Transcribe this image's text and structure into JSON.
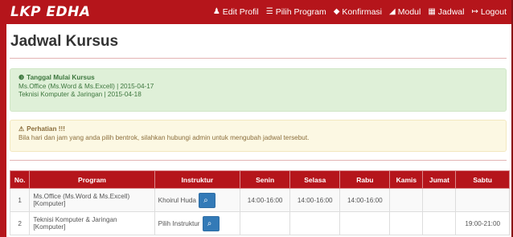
{
  "brand": "LKP EDHA",
  "nav": [
    {
      "label": "Edit Profil",
      "icon": "user-icon",
      "glyph": "♟"
    },
    {
      "label": "Pilih Program",
      "icon": "list-icon",
      "glyph": "☰"
    },
    {
      "label": "Konfirmasi",
      "icon": "tag-icon",
      "glyph": "◆"
    },
    {
      "label": "Modul",
      "icon": "book-icon",
      "glyph": "◢"
    },
    {
      "label": "Jadwal",
      "icon": "calendar-icon",
      "glyph": "▦"
    },
    {
      "label": "Logout",
      "icon": "logout-icon",
      "glyph": "↦"
    }
  ],
  "page_title": "Jadwal Kursus",
  "alert_start": {
    "icon": "info-circle-icon",
    "heading": "Tanggal Mulai Kursus",
    "lines": [
      "Ms.Office (Ms.Word & Ms.Excell) | 2015-04-17",
      "Teknisi Komputer & Jaringan | 2015-04-18"
    ]
  },
  "alert_warning": {
    "icon": "warning-icon",
    "heading": "Perhatian !!!",
    "text": "Bila hari dan jam yang anda pilih bentrok, silahkan hubungi admin untuk mengubah jadwal tersebut."
  },
  "table": {
    "headers": [
      "No.",
      "Program",
      "Instruktur",
      "Senin",
      "Selasa",
      "Rabu",
      "Kamis",
      "Jumat",
      "Sabtu"
    ],
    "rows": [
      {
        "no": "1",
        "program": "Ms.Office (Ms.Word & Ms.Excell) [Komputer]",
        "instruktur": "Khoirul Huda",
        "senin": "14:00-16:00",
        "selasa": "14:00-16:00",
        "rabu": "14:00-16:00",
        "kamis": "",
        "jumat": "",
        "sabtu": ""
      },
      {
        "no": "2",
        "program": "Teknisi Komputer & Jaringan [Komputer]",
        "instruktur": "Pilih Instruktur",
        "senin": "",
        "selasa": "",
        "rabu": "",
        "kamis": "",
        "jumat": "",
        "sabtu": "19:00-21:00"
      }
    ]
  },
  "colors": {
    "primary": "#b5151b",
    "success_bg": "#dff0d8",
    "warning_bg": "#fcf8e3",
    "button": "#337ab7"
  }
}
